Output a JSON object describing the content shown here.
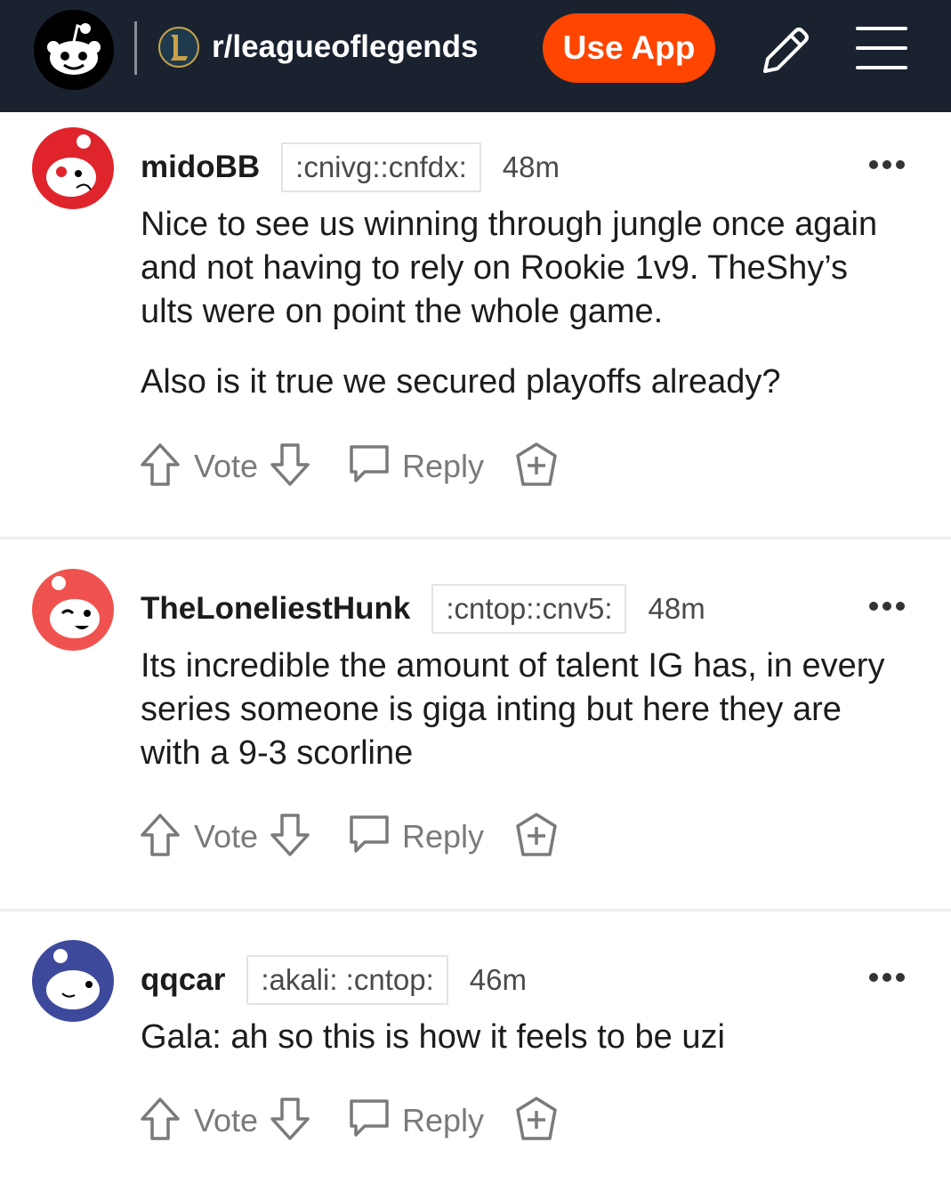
{
  "header": {
    "subreddit": "r/leagueoflegends",
    "use_app_label": "Use App",
    "icons": [
      "reddit-logo-icon",
      "subreddit-icon",
      "pencil-icon",
      "menu-icon"
    ],
    "accent": "#ff4500",
    "background": "#1a2230"
  },
  "comments": [
    {
      "username": "midoBB",
      "flair": ":cnivg::cnfdx:",
      "time": "48m",
      "paragraphs": [
        "Nice to see us winning through jungle once again and not having to rely on Rookie 1v9. TheShy’s ults were on point the whole game.",
        "Also is it true we secured playoffs already?"
      ],
      "vote_label": "Vote",
      "reply_label": "Reply",
      "avatar_color": "#e0242b"
    },
    {
      "username": "TheLoneliestHunk",
      "flair": ":cntop::cnv5:",
      "time": "48m",
      "paragraphs": [
        "Its incredible the amount of talent IG has, in every series someone is giga inting but here they are with a 9-3 scorline"
      ],
      "vote_label": "Vote",
      "reply_label": "Reply",
      "avatar_color": "#f0534f"
    },
    {
      "username": "qqcar",
      "flair": ":akali: :cntop:",
      "time": "46m",
      "paragraphs": [
        "Gala: ah so this is how it feels to be uzi"
      ],
      "vote_label": "Vote",
      "reply_label": "Reply",
      "avatar_color": "#3d4a9c"
    }
  ]
}
